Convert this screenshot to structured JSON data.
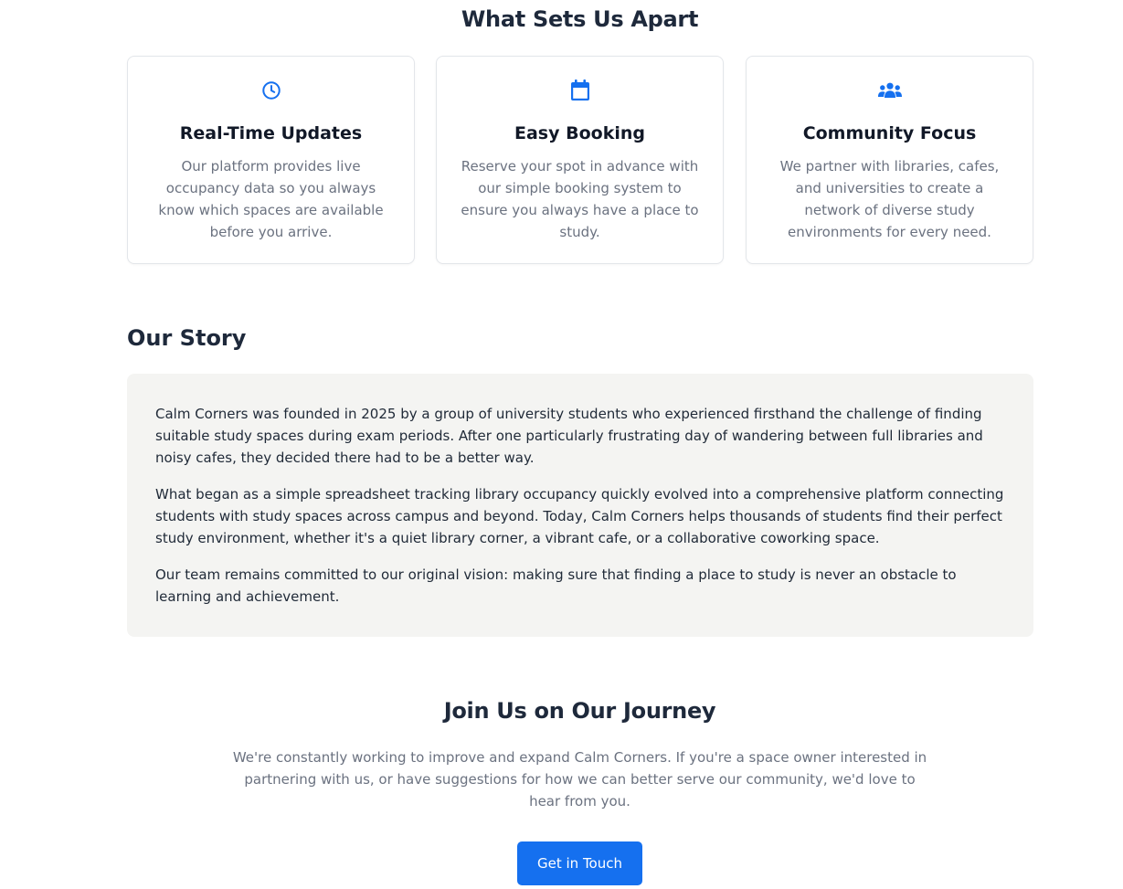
{
  "features": {
    "title": "What Sets Us Apart",
    "cards": [
      {
        "icon": "clock-icon",
        "title": "Real-Time Updates",
        "text": "Our platform provides live occupancy data so you always know which spaces are available before you arrive."
      },
      {
        "icon": "calendar-icon",
        "title": "Easy Booking",
        "text": "Reserve your spot in advance with our simple booking system to ensure you always have a place to study."
      },
      {
        "icon": "users-icon",
        "title": "Community Focus",
        "text": "We partner with libraries, cafes, and universities to create a network of diverse study environments for every need."
      }
    ]
  },
  "story": {
    "title": "Our Story",
    "paragraphs": [
      "Calm Corners was founded in 2025 by a group of university students who experienced firsthand the challenge of finding suitable study spaces during exam periods. After one particularly frustrating day of wandering between full libraries and noisy cafes, they decided there had to be a better way.",
      "What began as a simple spreadsheet tracking library occupancy quickly evolved into a comprehensive platform connecting students with study spaces across campus and beyond. Today, Calm Corners helps thousands of students find their perfect study environment, whether it's a quiet library corner, a vibrant cafe, or a collaborative coworking space.",
      "Our team remains committed to our original vision: making sure that finding a place to study is never an obstacle to learning and achievement."
    ]
  },
  "join": {
    "title": "Join Us on Our Journey",
    "text": "We're constantly working to improve and expand Calm Corners. If you're a space owner interested in partnering with us, or have suggestions for how we can better serve our community, we'd love to hear from you.",
    "button_label": "Get in Touch"
  },
  "colors": {
    "accent": "#1570ef",
    "story_background": "#f4f4f2"
  }
}
